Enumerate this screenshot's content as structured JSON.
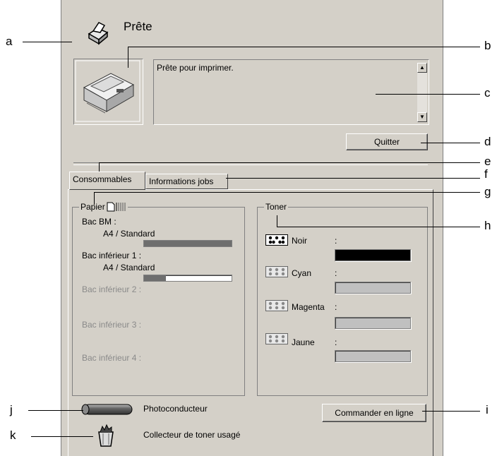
{
  "status": {
    "title": "Prête",
    "message": "Prête pour imprimer."
  },
  "buttons": {
    "quit": "Quitter",
    "order": "Commander en ligne"
  },
  "tabs": [
    {
      "label": "Consommables"
    },
    {
      "label": "Informations jobs"
    }
  ],
  "paper": {
    "title": "Papier",
    "trays": [
      {
        "name": "Bac BM :",
        "size": "A4 / Standard",
        "level": 1.0,
        "enabled": true
      },
      {
        "name": "Bac inférieur 1 :",
        "size": "A4 / Standard",
        "level": 0.25,
        "enabled": true
      },
      {
        "name": "Bac inférieur 2 :",
        "enabled": false
      },
      {
        "name": "Bac inférieur 3 :",
        "enabled": false
      },
      {
        "name": "Bac inférieur 4 :",
        "enabled": false
      }
    ]
  },
  "toner": {
    "title": "Toner",
    "colors": [
      {
        "name": "Noir",
        "colon": ":",
        "level": 1.0,
        "enabled": true
      },
      {
        "name": "Cyan",
        "colon": ":",
        "enabled": false
      },
      {
        "name": "Magenta",
        "colon": ":",
        "enabled": false
      },
      {
        "name": "Jaune",
        "colon": ":",
        "enabled": false
      }
    ]
  },
  "footer": {
    "photoconductor": "Photoconducteur",
    "waste_toner": "Collecteur de toner usagé"
  },
  "callouts": {
    "a": "a",
    "b": "b",
    "c": "c",
    "d": "d",
    "e": "e",
    "f": "f",
    "g": "g",
    "h": "h",
    "i": "i",
    "j": "j",
    "k": "k"
  },
  "icons": {
    "status": "printer-icon",
    "printer_image": "laser-printer-icon",
    "photoconductor": "photoconductor-drum-icon",
    "waste": "waste-toner-bin-icon",
    "paper": "paper-icon",
    "toner": "toner-dots-icon"
  },
  "colors": {
    "window": "#d4d0c8",
    "bar_fill": "#6e6e6e",
    "black_toner": "#000000"
  }
}
